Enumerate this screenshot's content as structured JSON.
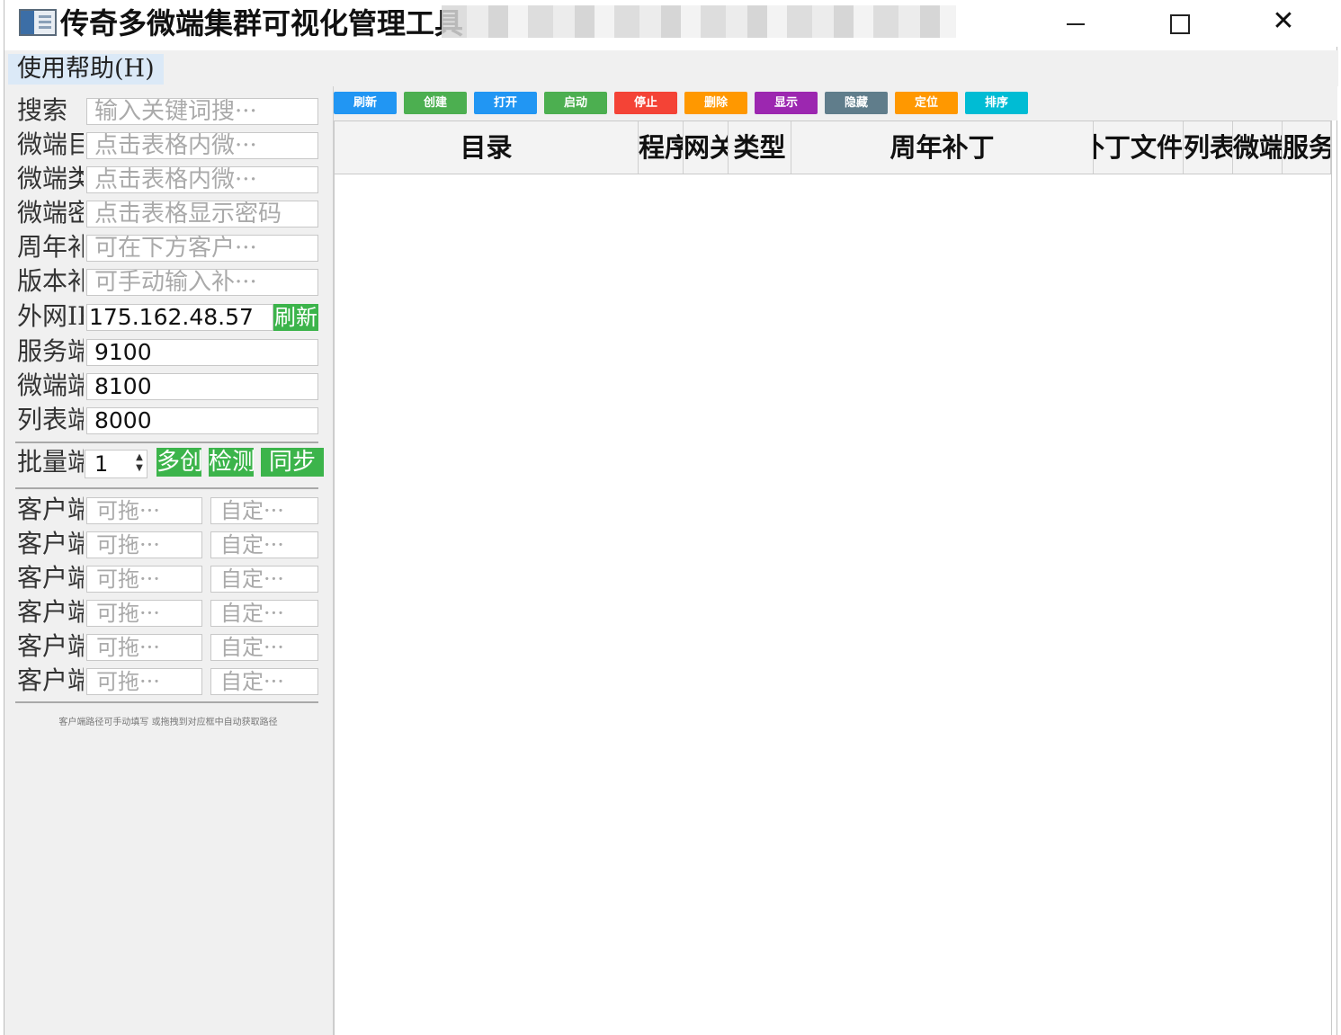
{
  "window": {
    "title": "传奇多微端集群可视化管理工具",
    "min_icon": "minimize-icon",
    "max_icon": "maximize-icon",
    "close_icon": "close-icon",
    "close_glyph": "✕"
  },
  "menu": {
    "help": "使用帮助(H)"
  },
  "form": {
    "search": {
      "label": "搜索",
      "placeholder": "输入关键词搜···"
    },
    "f1": {
      "label": "微端目",
      "placeholder": "点击表格内微···"
    },
    "f2": {
      "label": "微端类",
      "placeholder": "点击表格内微···"
    },
    "f3": {
      "label": "微端密",
      "placeholder": "点击表格显示密码"
    },
    "f4": {
      "label": "周年补",
      "placeholder": "可在下方客户···"
    },
    "f5": {
      "label": "版本补",
      "placeholder": "可手动输入补···"
    },
    "ip": {
      "label": "外网IP",
      "value": "175.162.48.57",
      "refresh": "刷新"
    },
    "service_port": {
      "label": "服务端",
      "value": "9100"
    },
    "micro_port": {
      "label": "微端端",
      "value": "8100"
    },
    "list_port": {
      "label": "列表端",
      "value": "8000"
    }
  },
  "batch": {
    "label": "批量端",
    "value": "1",
    "spin_up": "▲",
    "spin_down": "▼",
    "btn_create": "多创",
    "btn_check": "检测",
    "btn_sync": "同步"
  },
  "clients": [
    {
      "label": "客户端",
      "path_placeholder": "可拖···",
      "custom_placeholder": "自定···"
    },
    {
      "label": "客户端",
      "path_placeholder": "可拖···",
      "custom_placeholder": "自定···"
    },
    {
      "label": "客户端",
      "path_placeholder": "可拖···",
      "custom_placeholder": "自定···"
    },
    {
      "label": "客户端",
      "path_placeholder": "可拖···",
      "custom_placeholder": "自定···"
    },
    {
      "label": "客户端",
      "path_placeholder": "可拖···",
      "custom_placeholder": "自定···"
    },
    {
      "label": "客户端",
      "path_placeholder": "可拖···",
      "custom_placeholder": "自定···"
    }
  ],
  "hint": "客户端路径可手动填写 或拖拽到对应框中自动获取路径",
  "toolbar": {
    "buttons": [
      {
        "label": "刷新",
        "color": "#2196f3"
      },
      {
        "label": "创建",
        "color": "#4caf50"
      },
      {
        "label": "打开",
        "color": "#2196f3"
      },
      {
        "label": "启动",
        "color": "#4caf50"
      },
      {
        "label": "停止",
        "color": "#f44336"
      },
      {
        "label": "删除",
        "color": "#ff9800"
      },
      {
        "label": "显示",
        "color": "#9c27b0"
      },
      {
        "label": "隐藏",
        "color": "#607d8b"
      },
      {
        "label": "定位",
        "color": "#ff9800"
      },
      {
        "label": "排序",
        "color": "#00bcd4"
      }
    ]
  },
  "table": {
    "columns": [
      "目录",
      "程序",
      "网关",
      "类型",
      "周年补丁",
      "补丁文件",
      "列表",
      "微端",
      "服务"
    ]
  }
}
